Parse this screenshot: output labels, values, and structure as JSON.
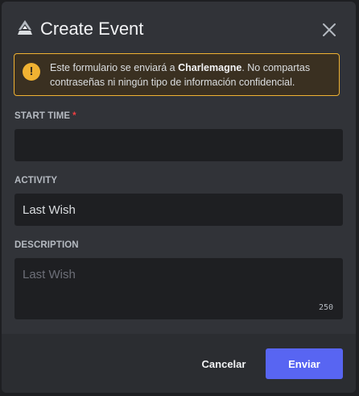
{
  "dialog": {
    "title": "Create Event",
    "icon": "app-icon",
    "close_icon": "close-icon"
  },
  "warning": {
    "icon": "exclamation-icon",
    "text_before": "Este formulario se enviará a ",
    "target": "Charlemagne",
    "text_after": ". No compartas contraseñas ni ningún tipo de información confidencial."
  },
  "fields": {
    "start_time": {
      "label": "START TIME",
      "required_mark": "*",
      "value": ""
    },
    "activity": {
      "label": "ACTIVITY",
      "value": "Last Wish"
    },
    "description": {
      "label": "DESCRIPTION",
      "placeholder": "Last Wish",
      "value": "",
      "remaining": "250"
    }
  },
  "footer": {
    "cancel_label": "Cancelar",
    "submit_label": "Enviar"
  },
  "colors": {
    "accent": "#5865f2",
    "warning": "#f0b232",
    "required": "#f23f42"
  }
}
